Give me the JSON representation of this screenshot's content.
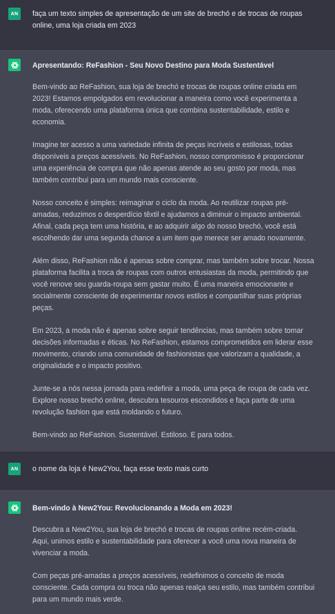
{
  "colors": {
    "user_bg": "#343541",
    "assistant_bg": "#444654",
    "user_avatar": "#18a37b",
    "assistant_avatar": "#19c37d"
  },
  "messages": [
    {
      "role": "user",
      "avatar": "AN",
      "text": "faça um texto simples de apresentação de um site de brechó e de trocas de roupas online, uma loja criada em 2023"
    },
    {
      "role": "assistant",
      "avatar_icon": "openai-logo-icon",
      "heading": "Apresentando: ReFashion - Seu Novo Destino para Moda Sustentável",
      "paragraphs": [
        "Bem-vindo ao ReFashion, sua loja de brechó e trocas de roupas online criada em 2023! Estamos empolgados em revolucionar a maneira como você experimenta a moda, oferecendo uma plataforma única que combina sustentabilidade, estilo e economia.",
        "Imagine ter acesso a uma variedade infinita de peças incríveis e estilosas, todas disponíveis a preços acessíveis. No ReFashion, nosso compromisso é proporcionar uma experiência de compra que não apenas atende ao seu gosto por moda, mas também contribui para um mundo mais consciente.",
        "Nosso conceito é simples: reimaginar o ciclo da moda. Ao reutilizar roupas pré-amadas, reduzimos o desperdício têxtil e ajudamos a diminuir o impacto ambiental. Afinal, cada peça tem uma história, e ao adquirir algo do nosso brechó, você está escolhendo dar uma segunda chance a um item que merece ser amado novamente.",
        "Além disso, ReFashion não é apenas sobre comprar, mas também sobre trocar. Nossa plataforma facilita a troca de roupas com outros entusiastas da moda, permitindo que você renove seu guarda-roupa sem gastar muito. É uma maneira emocionante e socialmente consciente de experimentar novos estilos e compartilhar suas próprias peças.",
        "Em 2023, a moda não é apenas sobre seguir tendências, mas também sobre tomar decisões informadas e éticas. No ReFashion, estamos comprometidos em liderar esse movimento, criando uma comunidade de fashionistas que valorizam a qualidade, a originalidade e o impacto positivo.",
        "Junte-se a nós nessa jornada para redefinir a moda, uma peça de roupa de cada vez. Explore nosso brechó online, descubra tesouros escondidos e faça parte de uma revolução fashion que está moldando o futuro.",
        "Bem-vindo ao ReFashion. Sustentável. Estiloso. E para todos."
      ]
    },
    {
      "role": "user",
      "avatar": "AN",
      "text": "o nome da loja é New2You, faça esse texto mais curto"
    },
    {
      "role": "assistant",
      "avatar_icon": "openai-logo-icon",
      "heading": "Bem-vindo à New2You: Revolucionando a Moda em 2023!",
      "paragraphs": [
        "Descubra a New2You, sua loja de brechó e trocas de roupas online recém-criada. Aqui, unimos estilo e sustentabilidade para oferecer a você uma nova maneira de vivenciar a moda.",
        "Com peças pré-amadas a preços acessíveis, redefinimos o conceito de moda consciente. Cada compra ou troca não apenas realça seu estilo, mas também contribui para um mundo mais verde."
      ]
    }
  ]
}
